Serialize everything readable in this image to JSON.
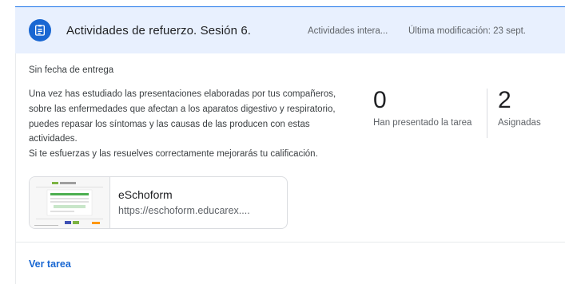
{
  "header": {
    "title": "Actividades de refuerzo. Sesión 6.",
    "topic": "Actividades intera...",
    "modified": "Última modificación: 23 sept."
  },
  "assignment": {
    "due": "Sin fecha de entrega",
    "description_lines": [
      "Una vez has estudiado las presentaciones elaboradas por tus compañeros,",
      "sobre las enfermedades que afectan a los aparatos digestivo y respiratorio,",
      "puedes repasar los síntomas y las causas de las producen con estas",
      "actividades.",
      "Si te esfuerzas y las resuelves correctamente mejorarás tu calificación."
    ]
  },
  "stats": {
    "turned_in_count": "0",
    "turned_in_label": "Han presentado la tarea",
    "assigned_count": "2",
    "assigned_label": "Asignadas"
  },
  "attachment": {
    "title": "eSchoform",
    "url": "https://eschoform.educarex...."
  },
  "footer": {
    "view_link": "Ver tarea"
  },
  "colors": {
    "accent": "#1967d2",
    "header_bg": "#e8f0fe"
  },
  "icons": {
    "header": "assignment-icon"
  }
}
